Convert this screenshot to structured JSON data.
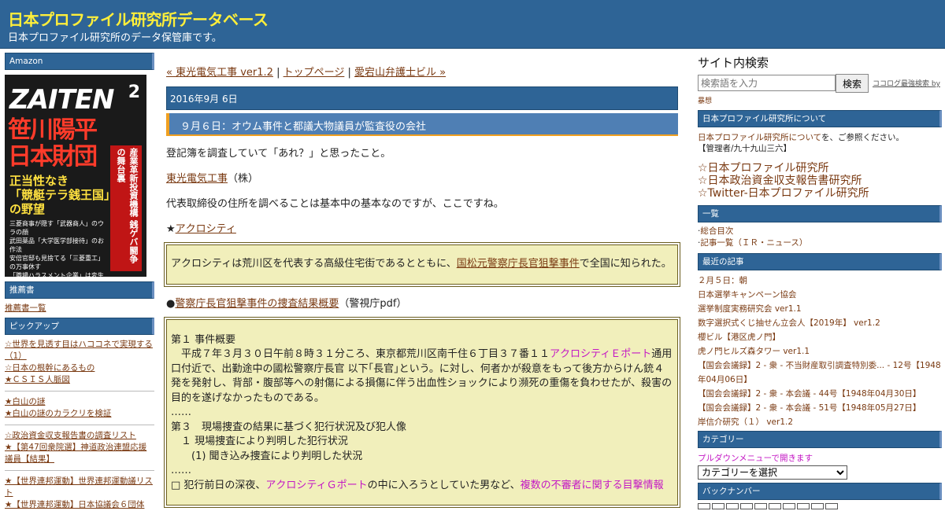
{
  "header": {
    "title": "日本プロファイル研究所データベース",
    "description": "日本プロファイル研究所のデータ保管庫です。"
  },
  "left": {
    "amazon_head": "Amazon",
    "cover": {
      "brand": "ZAITEN",
      "issue": "2",
      "headline": "笹川陽平\n日本財団",
      "sub": "正当性なき\n「競艇テラ銭王国」\nの野望",
      "vertical": "産業革新投資機構 銭ゲバ闘争の舞台裏",
      "lines": "三菱商事が隠す「武器商人」のウラの顔\n武田薬品「大学医学部接待」のお作法\n安倍官邸も見捨てる「三菱重工」の万事休す\n「職場ハラスメント企業」は変生するか？\nあきれた広報実話大賞は「島本製菓」に決定！"
    },
    "recommend_head": "推薦書",
    "recommend_link": "推薦書一覧",
    "pickup_head": "ピックアップ",
    "pickup_groups": [
      [
        "☆世界を見透す目はハココネで実現する（1）",
        "☆日本の根幹にあるもの",
        "★ＣＳＩＳ人脈図"
      ],
      [
        "★白山の謎",
        "★白山の謎のカラクリを検証"
      ],
      [
        "☆政治資金収支報告書の調査リスト",
        "★【第47回衆院選】神道政治連盟応援議員【結果】"
      ],
      [
        "★【世界連邦運動】世界連邦運動議リスト",
        "★【世界連邦運動】日本協議会６団体"
      ]
    ]
  },
  "main": {
    "nav": {
      "prev": "« 東光電気工事 ver1.2",
      "sep1": " | ",
      "top": "トップページ",
      "sep2": " | ",
      "next": "愛宕山弁護士ビル »"
    },
    "date": "2016年9月 6日",
    "post_title": "９月６日：オウム事件と都議大物議員が監査役の会社",
    "p1": "登記簿を調査していて「あれ？」と思ったこと。",
    "p2_link": "東光電気工事",
    "p2_rest": "（株）",
    "p3": "代表取締役の住所を調べることは基本中の基本なのですが、ここですね。",
    "p4_prefix": "★",
    "p4_link": "アクロシティ",
    "quote1": {
      "before": "アクロシティは荒川区を代表する高級住宅街であるとともに、",
      "link": "国松元警察庁長官狙撃事件",
      "after": "で全国に知られた。"
    },
    "p5_prefix": "●",
    "p5_link": "警察庁長官狙撃事件の捜査結果概要",
    "p5_rest": "（警視庁pdf）",
    "quote2": {
      "h1": "第１ 事件概要",
      "l1a": "　平成７年３月３０日午前８時３１分ころ、東京都荒川区南千住６丁目３７番１１",
      "l1hl": "アクロシティＥポート",
      "l1b": "通用口付近で、出勤途中の國松警察庁長官 以下｢長官｣という。に対し、何者かが殺意をもって後方からけん銃４発を発射し、背部・腹部等への射傷による損傷に伴う出血性ショックにより瀕死の重傷を負わせたが、殺害の目的を遂げなかったものである。",
      "dots1": "……",
      "h3": "第３　現場捜査の結果に基づく犯行状況及び犯人像",
      "s1": "　１ 現場捜査により判明した犯行状況",
      "s2": "　　(1) 聞き込み捜査により判明した状況",
      "dots2": "……",
      "l2a": "□ 犯行前日の深夜、",
      "l2hl": "アクロシティＧポート",
      "l2b": "の中に入ろうとしていた男など、",
      "l2hl2": "複数の不審者に関する目撃情報"
    }
  },
  "right": {
    "search_title": "サイト内検索",
    "search_placeholder": "検索語を入力",
    "search_button": "検索",
    "search_note": "ココログ最強検索 by",
    "search_note2": "暴想",
    "about_head": "日本プロファイル研究所について",
    "about_link": "日本プロファイル研究所について",
    "about_text": "を、ご参照ください。",
    "about_admin": "【管理者/九十九山三六】",
    "big_links": [
      "☆日本プロファイル研究所",
      "☆日本政治資金収支報告書研究所",
      "☆Twitter-日本プロファイル研究所"
    ],
    "list_head": "一覧",
    "list_items": [
      "総合目次",
      "記事一覧（ＩＲ・ニュース）"
    ],
    "recent_head": "最近の記事",
    "recent_items": [
      "２月５日：朝",
      "日本選挙キャンペーン協会",
      "選挙制度実務研究会 ver1.1",
      "数字選択式くじ抽せん立会人【2019年】 ver1.2",
      "櫻ビル【港区虎ノ門】",
      "虎ノ門ヒルズ森タワー ver1.1",
      "【国会会議録】2 - 衆 - 不当財産取引調査特別委... - 12号【1948年04月06日】",
      "【国会会議録】2 - 衆 - 本会議 - 44号【1948年04月30日】",
      "【国会会議録】2 - 衆 - 本会議 - 51号【1948年05月27日】",
      "岸信介研究（１） ver1.2"
    ],
    "category_head": "カテゴリー",
    "category_note": "プルダウンメニューで開きます",
    "category_select": "カテゴリーを選択",
    "backnum_head": "バックナンバー"
  }
}
